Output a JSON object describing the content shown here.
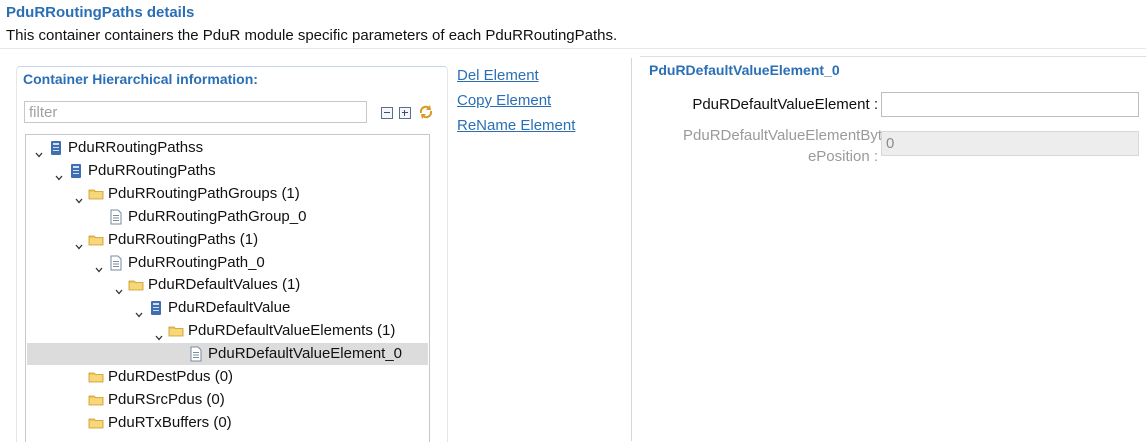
{
  "header": {
    "title": "PduRRoutingPaths details",
    "description": "This container containers the PduR module specific parameters of each PduRRoutingPaths."
  },
  "left_panel": {
    "title": "Container Hierarchical information:",
    "filter_placeholder": "filter",
    "filter_value": ""
  },
  "tree": {
    "items": [
      {
        "label": "PduRRoutingPathss",
        "icon": "module-icon",
        "expanded": true,
        "depth": 0
      },
      {
        "label": "PduRRoutingPaths",
        "icon": "module-icon",
        "expanded": true,
        "depth": 1
      },
      {
        "label": "PduRRoutingPathGroups (1)",
        "icon": "folder-icon",
        "expanded": true,
        "depth": 2
      },
      {
        "label": "PduRRoutingPathGroup_0",
        "icon": "document-icon",
        "expanded": null,
        "depth": 3
      },
      {
        "label": "PduRRoutingPaths (1)",
        "icon": "folder-icon",
        "expanded": true,
        "depth": 2
      },
      {
        "label": "PduRRoutingPath_0",
        "icon": "document-icon",
        "expanded": true,
        "depth": 3
      },
      {
        "label": "PduRDefaultValues (1)",
        "icon": "folder-icon",
        "expanded": true,
        "depth": 4
      },
      {
        "label": "PduRDefaultValue",
        "icon": "module-icon",
        "expanded": true,
        "depth": 5
      },
      {
        "label": "PduRDefaultValueElements (1)",
        "icon": "folder-icon",
        "expanded": true,
        "depth": 6
      },
      {
        "label": "PduRDefaultValueElement_0",
        "icon": "document-icon",
        "expanded": null,
        "depth": 7,
        "selected": true
      },
      {
        "label": "PduRDestPdus (0)",
        "icon": "folder-icon",
        "expanded": null,
        "depth": 2
      },
      {
        "label": "PduRSrcPdus (0)",
        "icon": "folder-icon",
        "expanded": null,
        "depth": 2
      },
      {
        "label": "PduRTxBuffers (0)",
        "icon": "folder-icon",
        "expanded": null,
        "depth": 2
      }
    ]
  },
  "actions": {
    "del": "Del Element",
    "copy": "Copy Element",
    "rename": "ReName Element"
  },
  "right_panel": {
    "title": "PduRDefaultValueElement_0",
    "fields": [
      {
        "label": "PduRDefaultValueElement :",
        "value": "",
        "enabled": true
      },
      {
        "label_line1": "PduRDefaultValueElementByt",
        "label_line2": "ePosition :",
        "value": "0",
        "enabled": false
      }
    ]
  },
  "colors": {
    "accent": "#2a6fb5",
    "selection": "#dcdcdc",
    "folder": "#f2c552",
    "module": "#3f6fb0"
  }
}
